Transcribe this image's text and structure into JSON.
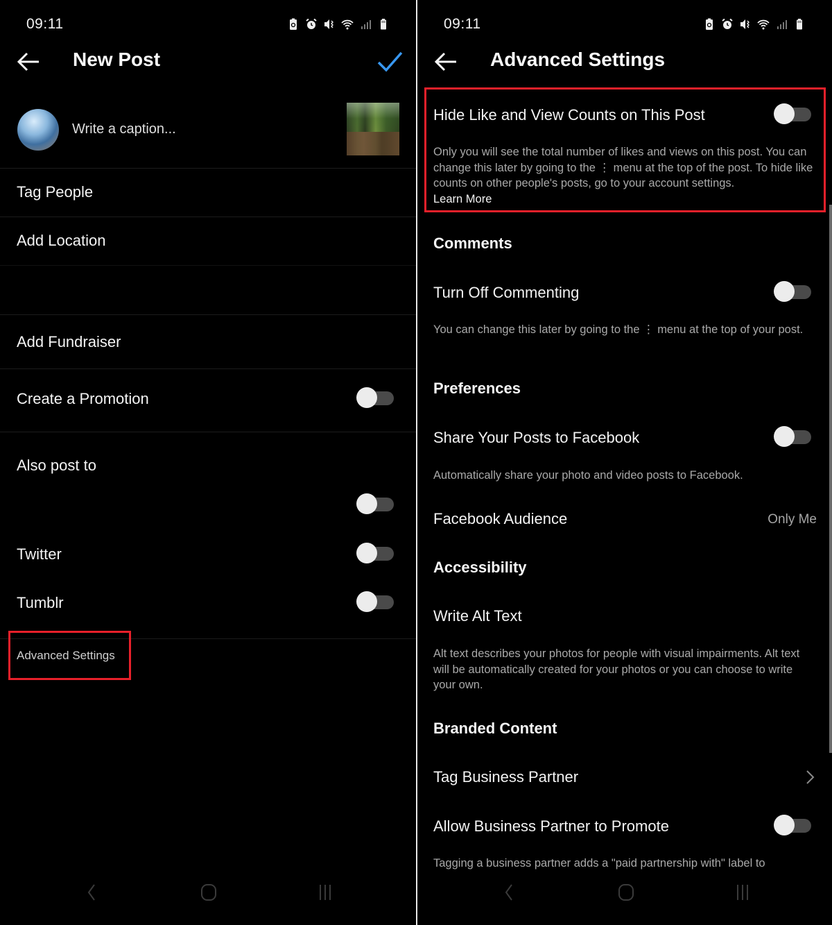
{
  "status_bar": {
    "time": "09:11",
    "icons": [
      "battery-saver-icon",
      "alarm-icon",
      "mute-icon",
      "wifi-icon",
      "signal-icon",
      "battery-icon"
    ]
  },
  "left_screen": {
    "title": "New Post",
    "back_icon": "arrow-left-icon",
    "confirm_icon": "checkmark-icon",
    "caption_placeholder": "Write a caption...",
    "menu": {
      "tag_people": "Tag People",
      "add_location": "Add Location",
      "add_fundraiser": "Add Fundraiser",
      "create_promotion": {
        "label": "Create a Promotion",
        "on": false
      },
      "also_post_to": "Also post to",
      "unnamed_toggle": {
        "on": false
      },
      "twitter": {
        "label": "Twitter",
        "on": false
      },
      "tumblr": {
        "label": "Tumblr",
        "on": false
      },
      "advanced_settings": "Advanced Settings"
    }
  },
  "right_screen": {
    "title": "Advanced Settings",
    "back_icon": "arrow-left-icon",
    "hide_counts": {
      "label": "Hide Like and View Counts on This Post",
      "on": false,
      "description": "Only you will see the total number of likes and views on this post. You can change this later by going to the ⋮ menu at the top of the post. To hide like counts on other people's posts, go to your account settings.",
      "learn_more": "Learn More"
    },
    "comments": {
      "heading": "Comments",
      "turn_off_commenting": {
        "label": "Turn Off Commenting",
        "on": false
      },
      "description": "You can change this later by going to the ⋮ menu at the top of your post."
    },
    "preferences": {
      "heading": "Preferences",
      "share_facebook": {
        "label": "Share Your Posts to Facebook",
        "on": false
      },
      "description": "Automatically share your photo and video posts to Facebook.",
      "facebook_audience": {
        "label": "Facebook Audience",
        "value": "Only Me"
      }
    },
    "accessibility": {
      "heading": "Accessibility",
      "write_alt_text": "Write Alt Text",
      "description": "Alt text describes your photos for people with visual impairments. Alt text will be automatically created for your photos or you can choose to write your own."
    },
    "branded_content": {
      "heading": "Branded Content",
      "tag_business_partner": "Tag Business Partner",
      "allow_partner_promote": {
        "label": "Allow Business Partner to Promote",
        "on": false
      },
      "description": "Tagging a business partner adds a \"paid partnership with\" label to"
    }
  },
  "nav_bar": {
    "icons": [
      "nav-back-icon",
      "nav-home-icon",
      "nav-recents-icon"
    ]
  },
  "colors": {
    "accent_blue": "#3897f0",
    "highlight_red": "#e8202a",
    "toggle_track": "#4a4a4a",
    "toggle_knob": "#ececec"
  }
}
